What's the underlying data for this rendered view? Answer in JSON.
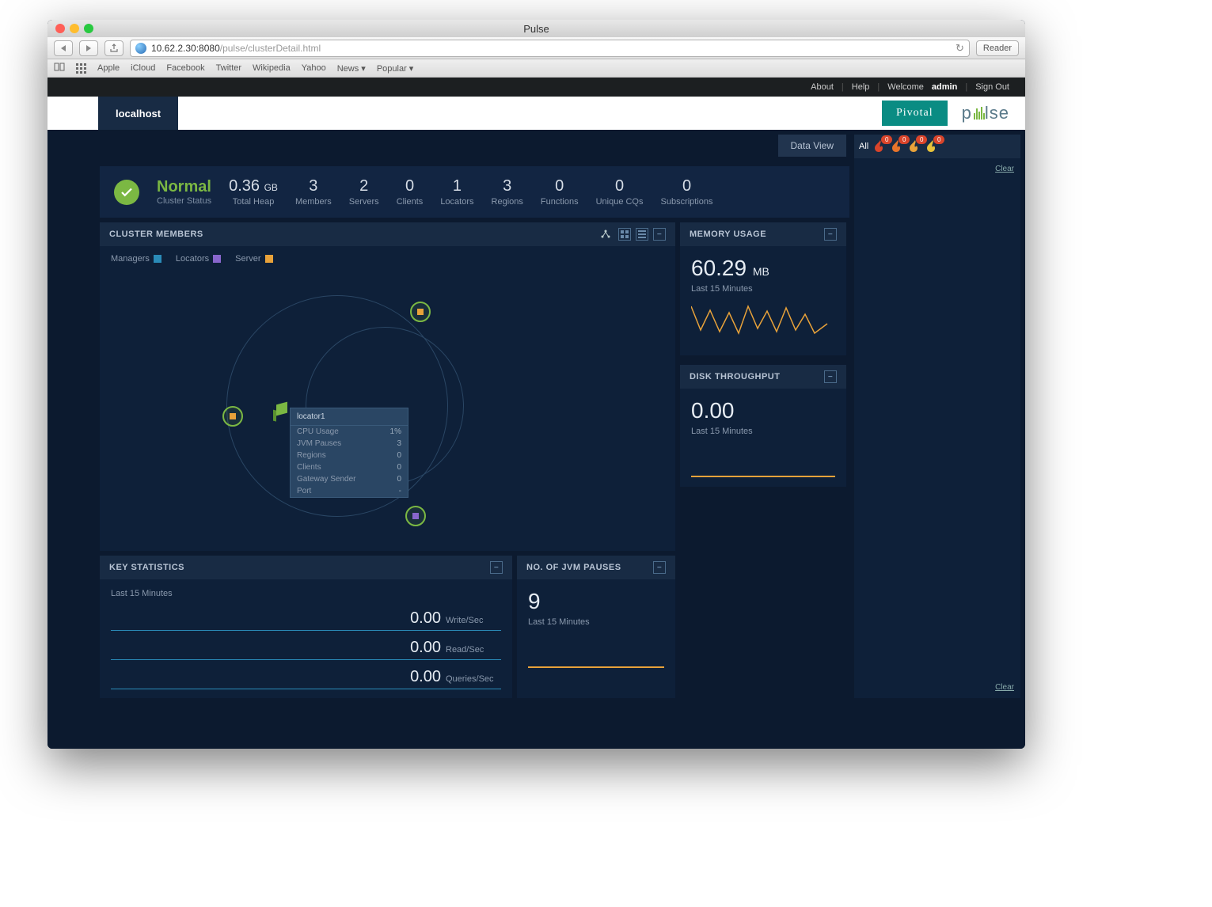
{
  "browser": {
    "window_title": "Pulse",
    "url_host": "10.62.2.30:8080",
    "url_path": "/pulse/clusterDetail.html",
    "reader": "Reader",
    "bookmarks": [
      "Apple",
      "iCloud",
      "Facebook",
      "Twitter",
      "Wikipedia",
      "Yahoo",
      "News ▾",
      "Popular ▾"
    ]
  },
  "top_links": {
    "about": "About",
    "help": "Help",
    "welcome": "Welcome",
    "user": "admin",
    "signout": "Sign Out"
  },
  "header": {
    "tab": "localhost",
    "brand1": "Pivotal",
    "brand2": "pulse"
  },
  "toolbar": {
    "data_view": "Data View"
  },
  "status": {
    "label": "Normal",
    "sub": "Cluster Status",
    "metrics": [
      {
        "value": "0.36",
        "unit": "GB",
        "label": "Total Heap"
      },
      {
        "value": "3",
        "unit": "",
        "label": "Members"
      },
      {
        "value": "2",
        "unit": "",
        "label": "Servers"
      },
      {
        "value": "0",
        "unit": "",
        "label": "Clients"
      },
      {
        "value": "1",
        "unit": "",
        "label": "Locators"
      },
      {
        "value": "3",
        "unit": "",
        "label": "Regions"
      },
      {
        "value": "0",
        "unit": "",
        "label": "Functions"
      },
      {
        "value": "0",
        "unit": "",
        "label": "Unique CQs"
      },
      {
        "value": "0",
        "unit": "",
        "label": "Subscriptions"
      }
    ]
  },
  "cluster": {
    "title": "CLUSTER MEMBERS",
    "legend": {
      "managers": "Managers",
      "locators": "Locators",
      "server": "Server"
    },
    "colors": {
      "managers": "#2a8bb8",
      "locators": "#8866cc",
      "server": "#e8a23a"
    },
    "tooltip": {
      "name": "locator1",
      "rows": [
        {
          "k": "CPU Usage",
          "v": "1%"
        },
        {
          "k": "JVM Pauses",
          "v": "3"
        },
        {
          "k": "Regions",
          "v": "0"
        },
        {
          "k": "Clients",
          "v": "0"
        },
        {
          "k": "Gateway Sender",
          "v": "0"
        },
        {
          "k": "Port",
          "v": "-"
        }
      ]
    }
  },
  "key_stats": {
    "title": "KEY STATISTICS",
    "sub": "Last 15 Minutes",
    "rows": [
      {
        "val": "0.00",
        "lab": "Write/Sec"
      },
      {
        "val": "0.00",
        "lab": "Read/Sec"
      },
      {
        "val": "0.00",
        "lab": "Queries/Sec"
      }
    ]
  },
  "jvm": {
    "title": "NO. OF JVM PAUSES",
    "value": "9",
    "sub": "Last 15 Minutes"
  },
  "memory": {
    "title": "MEMORY USAGE",
    "value": "60.29",
    "unit": "MB",
    "sub": "Last 15 Minutes"
  },
  "disk": {
    "title": "DISK THROUGHPUT",
    "value": "0.00",
    "sub": "Last 15 Minutes"
  },
  "alerts": {
    "all": "All",
    "badges": [
      "0",
      "0",
      "0",
      "0"
    ],
    "clear": "Clear"
  },
  "chart_data": {
    "type": "line",
    "title": "Memory Usage",
    "ylabel": "MB",
    "x": [
      0,
      1,
      2,
      3,
      4,
      5,
      6,
      7,
      8,
      9,
      10,
      11,
      12,
      13,
      14
    ],
    "values": [
      70,
      40,
      65,
      38,
      60,
      35,
      68,
      42,
      62,
      38,
      66,
      40,
      58,
      36,
      45
    ],
    "ylim": [
      30,
      75
    ]
  }
}
